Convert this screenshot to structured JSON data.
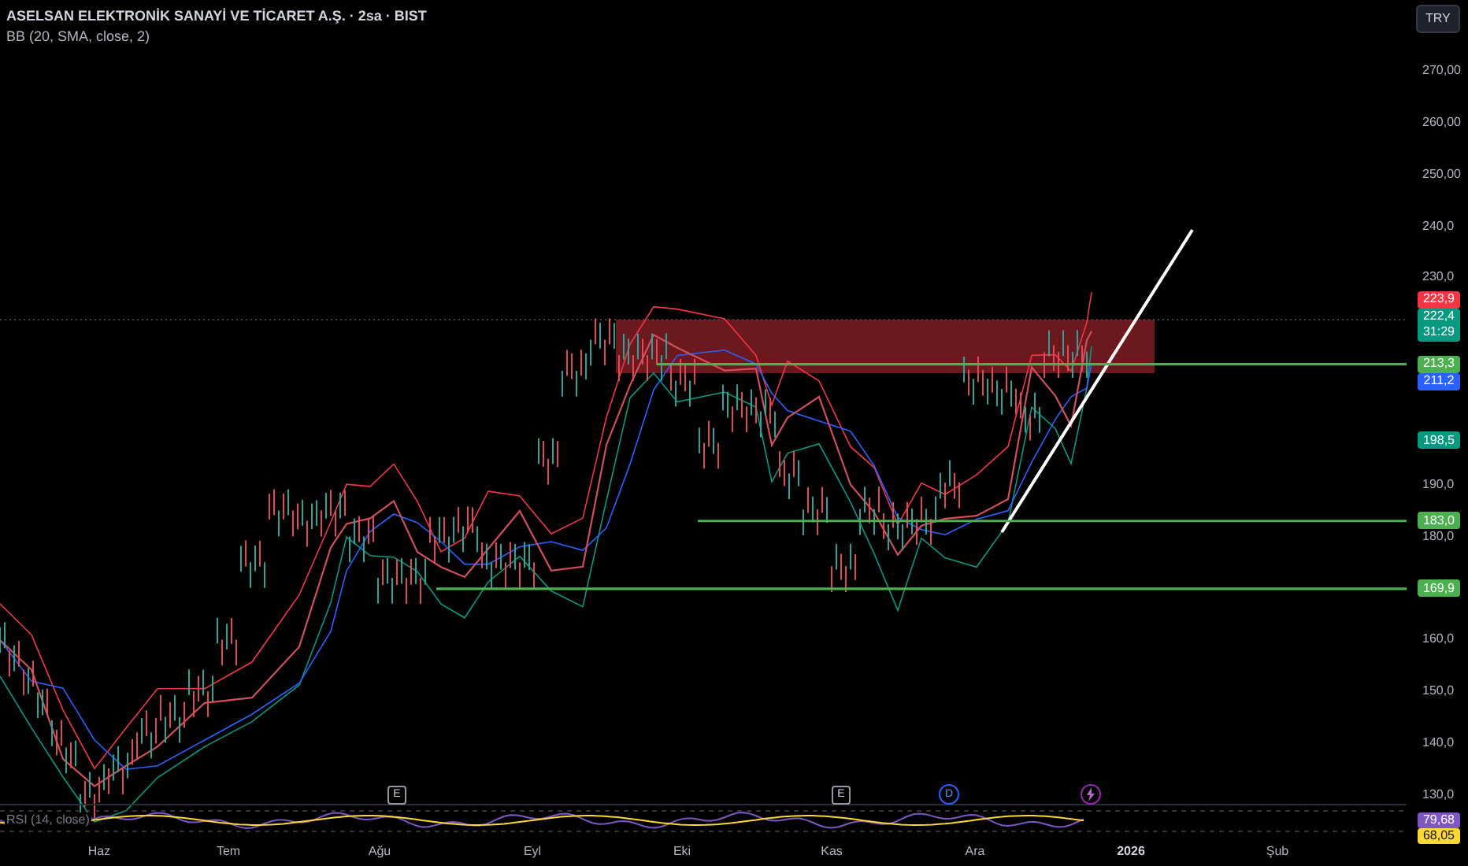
{
  "header": {
    "symbol_title": "ASELSAN ELEKTRONİK SANAYİ VE TİCARET A.Ş. · 2sa · BIST",
    "indicator": "BB (20, SMA, close, 2)"
  },
  "currency_button": "TRY",
  "price_axis": [
    "270,00",
    "260,00",
    "250,00",
    "240,0",
    "230,0",
    "190,0",
    "180,0",
    "160,0",
    "150,0",
    "140,0",
    "130,0"
  ],
  "price_badges": [
    {
      "text": "223,9",
      "color": "#f23645",
      "kind": "price"
    },
    {
      "text": "222,4",
      "sub": "31:29",
      "color": "#089981",
      "kind": "price"
    },
    {
      "text": "213,3",
      "color": "#4caf50",
      "kind": "level"
    },
    {
      "text": "211,2",
      "color": "#2962ff",
      "kind": "price"
    },
    {
      "text": "198,5",
      "color": "#089981",
      "kind": "price"
    },
    {
      "text": "183,0",
      "color": "#4caf50",
      "kind": "level"
    },
    {
      "text": "169,9",
      "color": "#4caf50",
      "kind": "level"
    }
  ],
  "events": [
    {
      "text": "E",
      "kind": "earnings"
    },
    {
      "text": "E",
      "kind": "earnings"
    },
    {
      "text": "D",
      "kind": "dividend"
    },
    {
      "kind": "split"
    }
  ],
  "rsi": {
    "label": "RSI (14, close)",
    "badges": [
      {
        "text": "79,68",
        "color": "#7e57c2"
      },
      {
        "text": "68,05",
        "color": "#fdd835"
      }
    ]
  },
  "time_axis": [
    {
      "text": "Haz",
      "year": false
    },
    {
      "text": "Tem",
      "year": false
    },
    {
      "text": "Ağu",
      "year": false
    },
    {
      "text": "Eyl",
      "year": false
    },
    {
      "text": "Eki",
      "year": false
    },
    {
      "text": "Kas",
      "year": false
    },
    {
      "text": "Ara",
      "year": false
    },
    {
      "text": "2026",
      "year": true
    },
    {
      "text": "Şub",
      "year": false
    }
  ]
}
